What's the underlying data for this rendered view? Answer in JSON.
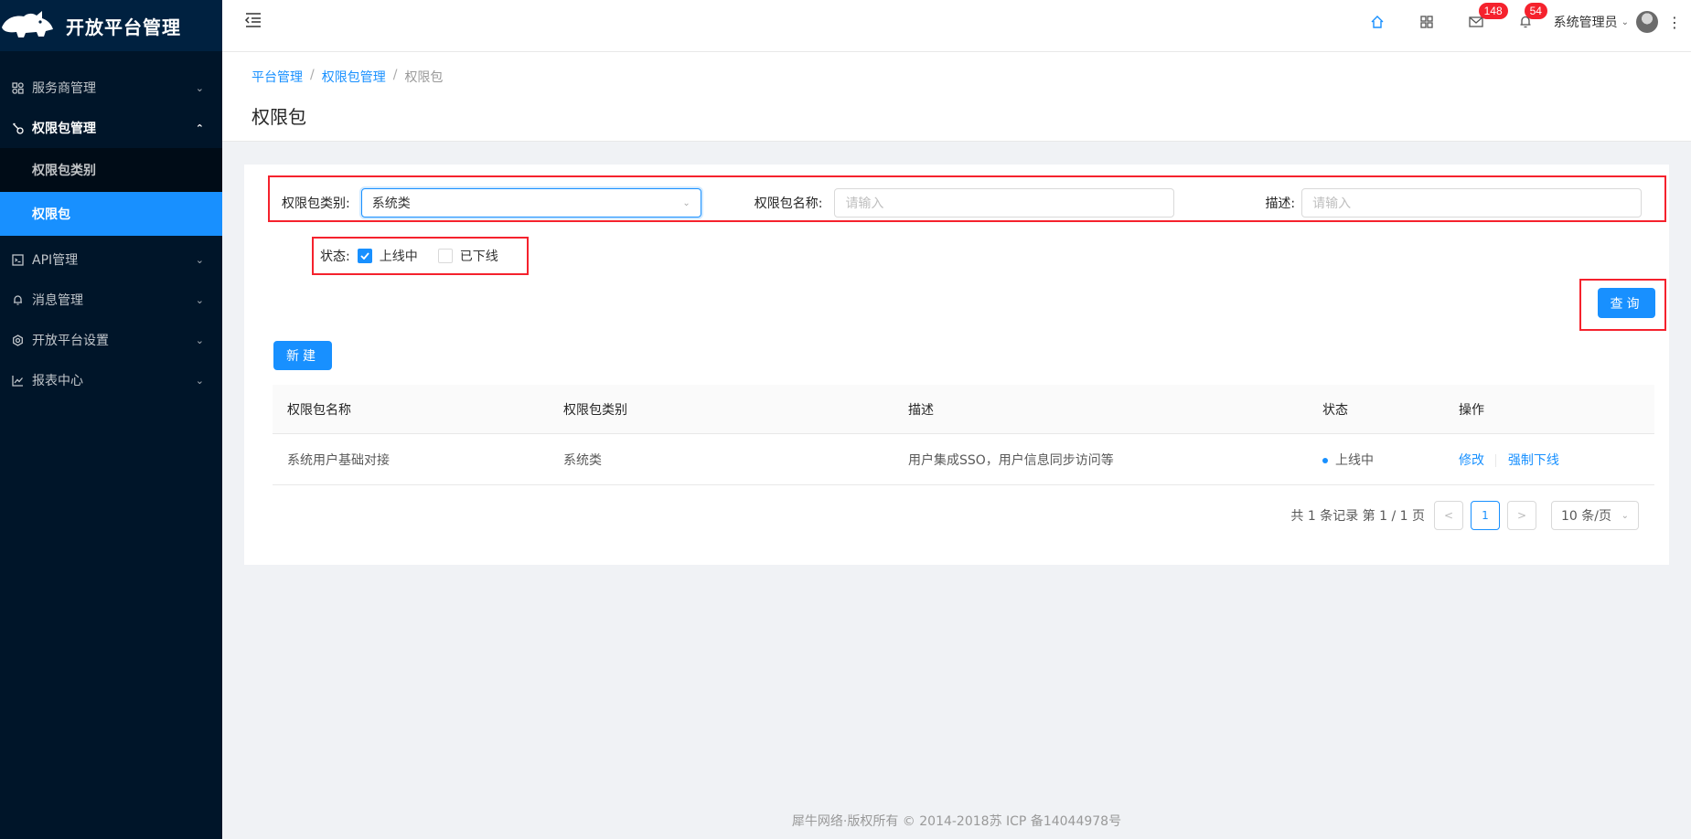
{
  "app": {
    "title": "开放平台管理"
  },
  "sidebar": {
    "items": [
      {
        "label": "服务商管理",
        "icon": "team-icon"
      },
      {
        "label": "权限包管理",
        "icon": "key-icon",
        "open": true,
        "children": [
          {
            "label": "权限包类别"
          },
          {
            "label": "权限包",
            "active": true
          }
        ]
      },
      {
        "label": "API管理",
        "icon": "api-icon"
      },
      {
        "label": "消息管理",
        "icon": "bell-icon"
      },
      {
        "label": "开放平台设置",
        "icon": "setting-icon"
      },
      {
        "label": "报表中心",
        "icon": "chart-icon"
      }
    ]
  },
  "header": {
    "mail_badge": "148",
    "bell_badge": "54",
    "user_name": "系统管理员"
  },
  "breadcrumb": [
    "平台管理",
    "权限包管理",
    "权限包"
  ],
  "page": {
    "title": "权限包"
  },
  "form": {
    "category_label": "权限包类别:",
    "category_value": "系统类",
    "name_label": "权限包名称:",
    "name_placeholder": "请输入",
    "desc_label": "描述:",
    "desc_placeholder": "请输入",
    "status_label": "状态:",
    "status_online": "上线中",
    "status_offline": "已下线",
    "online_checked": true,
    "offline_checked": false,
    "query_button": "查询",
    "new_button": "新建"
  },
  "table": {
    "columns": [
      "权限包名称",
      "权限包类别",
      "描述",
      "状态",
      "操作"
    ],
    "rows": [
      {
        "name": "系统用户基础对接",
        "category": "系统类",
        "desc": "用户集成SSO，用户信息同步访问等",
        "status": "上线中",
        "actions": [
          "修改",
          "强制下线"
        ]
      }
    ]
  },
  "pagination": {
    "summary": "共 1 条记录 第 1 / 1 页",
    "current": "1",
    "page_size": "10 条/页"
  },
  "footer": {
    "text": "犀牛网络·版权所有 © 2014-2018苏 ICP 备14044978号"
  },
  "colors": {
    "sidebar_bg": "#001529",
    "primary": "#1890ff",
    "highlight": "#f5222d",
    "badge": "#f5222d"
  }
}
